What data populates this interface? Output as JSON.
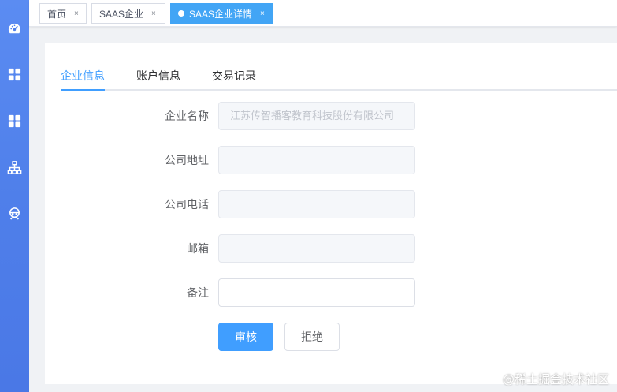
{
  "sidebar": {
    "icons": [
      {
        "name": "dashboard-icon"
      },
      {
        "name": "grid-icon"
      },
      {
        "name": "grid-icon"
      },
      {
        "name": "org-chart-icon"
      },
      {
        "name": "user-service-icon"
      }
    ]
  },
  "tagbar": {
    "tags": [
      {
        "label": "首页",
        "close": "×",
        "active": false
      },
      {
        "label": "SAAS企业",
        "close": "×",
        "active": false
      },
      {
        "label": "SAAS企业详情",
        "close": "×",
        "active": true
      }
    ]
  },
  "tabs": [
    {
      "label": "企业信息",
      "active": true
    },
    {
      "label": "账户信息",
      "active": false
    },
    {
      "label": "交易记录",
      "active": false
    }
  ],
  "form": {
    "company_name": {
      "label": "企业名称",
      "value": "江苏传智播客教育科技股份有限公司"
    },
    "company_address": {
      "label": "公司地址",
      "value": ""
    },
    "company_phone": {
      "label": "公司电话",
      "value": ""
    },
    "email": {
      "label": "邮箱",
      "value": ""
    },
    "remark": {
      "label": "备注",
      "value": ""
    }
  },
  "actions": {
    "approve_label": "审核",
    "reject_label": "拒绝"
  },
  "watermark": "@稀土掘金技术社区",
  "colors": {
    "sidebar": "#4f7fea",
    "primary": "#409eff",
    "active_tag": "#42a5f5"
  }
}
